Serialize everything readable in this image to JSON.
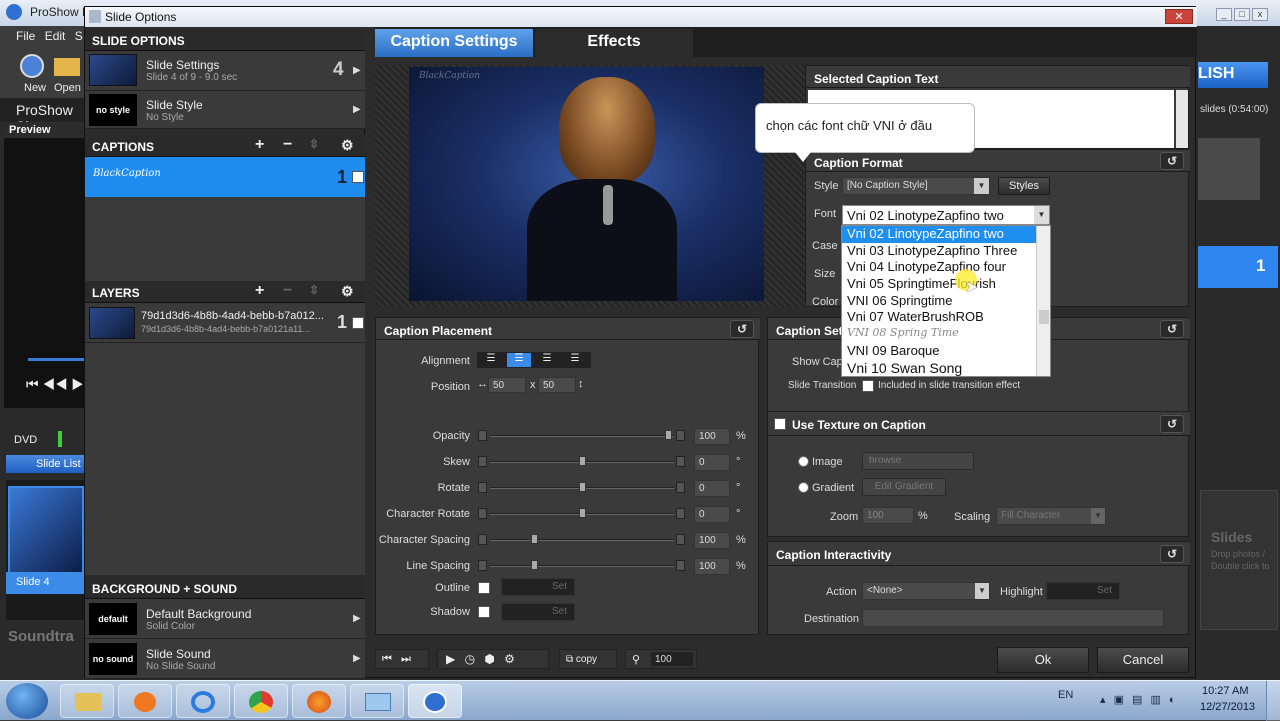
{
  "background_app": {
    "title": "ProShow P",
    "menu": [
      "File",
      "Edit",
      "S"
    ],
    "new_label": "New",
    "open_label": "Open",
    "proshow_label": "ProShow Sl",
    "preview_label": "Preview",
    "dvd_label": "DVD",
    "slide_list_tab": "Slide List",
    "slide_label": "Slide 4",
    "soundtrack_label": "Soundtra",
    "publish_label": "LISH",
    "slides_count": "slides (0:54:00)",
    "slide_number": "1",
    "slides_heading": "Slides",
    "slides_hint1": "Drop photos /",
    "slides_hint2": "Double click to"
  },
  "dialog": {
    "title": "Slide Options",
    "close_label": "✕"
  },
  "left_panel": {
    "slide_options_header": "SLIDE OPTIONS",
    "slide_settings_title": "Slide Settings",
    "slide_settings_sub": "Slide 4 of 9 - 9.0 sec",
    "slide_settings_number": "4",
    "slide_style_thumb": "no style",
    "slide_style_title": "Slide Style",
    "slide_style_sub": "No Style",
    "captions_header": "CAPTIONS",
    "caption_item_text": "BlackCaption",
    "caption_item_number": "1",
    "layers_header": "LAYERS",
    "layer_title": "79d1d3d6-4b8b-4ad4-bebb-b7a012...",
    "layer_sub": "79d1d3d6-4b8b-4ad4-bebb-b7a0121a11...",
    "layer_number": "1",
    "bg_sound_header": "BACKGROUND + SOUND",
    "bg_thumb": "default",
    "bg_title": "Default Background",
    "bg_sub": "Solid Color",
    "sound_thumb": "no sound",
    "sound_title": "Slide Sound",
    "sound_sub": "No Slide Sound"
  },
  "tabs": {
    "caption_settings": "Caption Settings",
    "effects": "Effects"
  },
  "preview": {
    "watermark": "BlackCaption"
  },
  "tooltip": {
    "text": "chọn các font chữ VNI ở đầu"
  },
  "selected_caption": {
    "header": "Selected Caption Text"
  },
  "caption_format": {
    "header": "Caption Format",
    "style_label": "Style",
    "style_value": "[No Caption Style]",
    "styles_button": "Styles",
    "font_label": "Font",
    "font_value": "Vni 02 LinotypeZapfino two",
    "case_label": "Case",
    "size_label": "Size",
    "color_label": "Color",
    "font_options": [
      "Vni 02 LinotypeZapfino two",
      "Vni 03 LinotypeZapfino Three",
      "Vni 04 LinotypeZapfino four",
      "Vni 05 SpringtimeFlourish",
      "VNI 06 Springtime",
      "Vni 07 WaterBrushROB",
      "VNI 08 Spring Time",
      "VNI 09 Baroque",
      "Vni 10 Swan Song"
    ]
  },
  "caption_settings_panel": {
    "header": "Caption Set",
    "show_caption": "Show Capt",
    "slide_transition_label": "Slide Transition",
    "slide_transition_check": "Included in slide transition effect"
  },
  "caption_placement": {
    "header": "Caption Placement",
    "alignment_label": "Alignment",
    "position_label": "Position",
    "pos_x": "50",
    "pos_sep": "x",
    "pos_y": "50",
    "sliders": [
      {
        "label": "Opacity",
        "value": "100",
        "unit": "%",
        "level": 0.97
      },
      {
        "label": "Skew",
        "value": "0",
        "unit": "°",
        "level": 0.5
      },
      {
        "label": "Rotate",
        "value": "0",
        "unit": "°",
        "level": 0.5
      },
      {
        "label": "Character Rotate",
        "value": "0",
        "unit": "°",
        "level": 0.5
      },
      {
        "label": "Character Spacing",
        "value": "100",
        "unit": "%",
        "level": 0.24
      },
      {
        "label": "Line Spacing",
        "value": "100",
        "unit": "%",
        "level": 0.24
      }
    ],
    "outline_label": "Outline",
    "shadow_label": "Shadow",
    "set_label": "Set"
  },
  "texture": {
    "header": "Use Texture on Caption",
    "image_label": "Image",
    "browse_label": "browse",
    "gradient_label": "Gradient",
    "edit_gradient_label": "Edit Gradient",
    "zoom_label": "Zoom",
    "zoom_value": "100",
    "zoom_unit": "%",
    "scaling_label": "Scaling",
    "scaling_value": "Fill Character"
  },
  "interactivity": {
    "header": "Caption Interactivity",
    "action_label": "Action",
    "action_value": "<None>",
    "highlight_label": "Highlight",
    "set_label": "Set",
    "destination_label": "Destination"
  },
  "bottom_bar": {
    "copy_label": "copy",
    "zoom_value": "100",
    "ok_label": "Ok",
    "cancel_label": "Cancel"
  },
  "taskbar": {
    "lang": "EN",
    "time": "10:27 AM",
    "date": "12/27/2013"
  }
}
